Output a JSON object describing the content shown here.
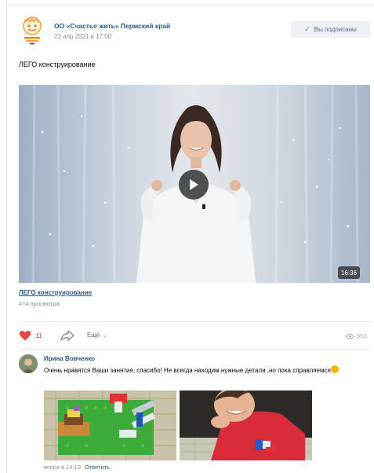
{
  "post": {
    "group_name": "ОО «Счастье жить» Пермский край",
    "date": "23 апр 2021 в 17:00",
    "subscribed_label": "Вы подписаны",
    "text": "ЛЕГО конструирование",
    "video": {
      "duration": "16:36",
      "title": "ЛЕГО конструирование",
      "views": "474 просмотра"
    },
    "actions": {
      "likes": "11",
      "more_label": "Ещё",
      "views": "553"
    },
    "comment": {
      "author": "Ирина Вовченко",
      "text": "Очень нравятся Ваши занятия, спасибо! Не всегда находим нужные детали ,но пока справляемся",
      "time": "вчера в 14:19",
      "reply_label": "Ответить"
    },
    "colors": {
      "link": "#2a5885",
      "like": "#e64646",
      "muted": "#818c99",
      "button_bg": "#eef0f3"
    },
    "icons": [
      "logo-icon",
      "check-icon",
      "play-icon",
      "heart-icon",
      "share-icon",
      "chevron-down-icon",
      "eye-icon"
    ]
  }
}
